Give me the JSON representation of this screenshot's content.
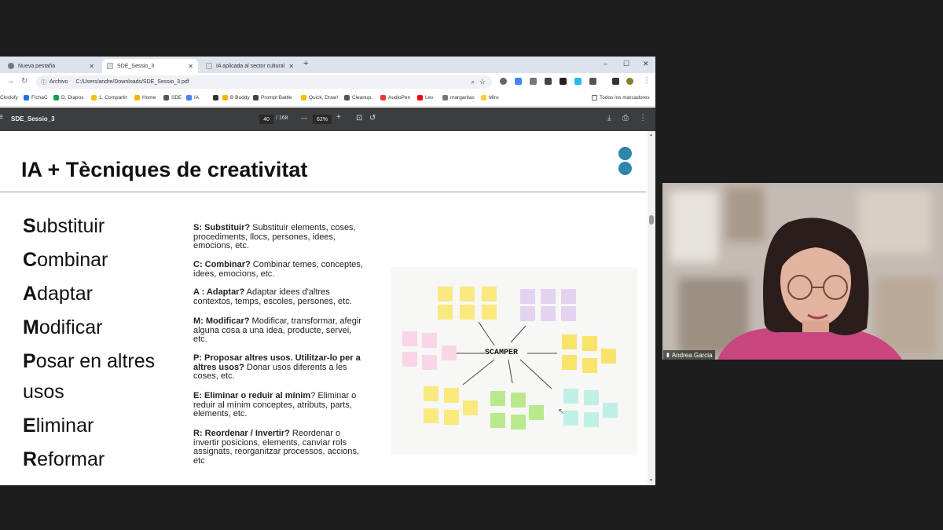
{
  "browser": {
    "tabs": [
      {
        "label": "Nueva pestaña",
        "active": false
      },
      {
        "label": "SDE_Sessio_3",
        "active": true
      },
      {
        "label": "IA aplicada al sector cultural",
        "active": false
      }
    ],
    "new_tab": "+",
    "win_minimize": "–",
    "win_maximize": "☐",
    "win_close": "✕",
    "address_chip": "Archivo",
    "address": "C:/Users/andre/Downloads/SDE_Sessio_3.pdf",
    "bookmarks": [
      {
        "label": "Clockify",
        "color": "#03a9f4"
      },
      {
        "label": "FichaC",
        "color": "#1a73e8"
      },
      {
        "label": "D. Diapos",
        "color": "#0f9d58"
      },
      {
        "label": "1. Compartir",
        "color": "#fbbc04"
      },
      {
        "label": "Home",
        "color": "#f4b400"
      },
      {
        "label": "SDE",
        "color": "#555555"
      },
      {
        "label": "IA",
        "color": "#4285f4"
      },
      {
        "label": "",
        "color": "#333333"
      },
      {
        "label": "B Buddy",
        "color": "#f4b400"
      },
      {
        "label": "Prompt Battle",
        "color": "#444444"
      },
      {
        "label": "Quick, Draw!",
        "color": "#fbbc04"
      },
      {
        "label": "Cleanup.",
        "color": "#555555"
      },
      {
        "label": "AudioPen",
        "color": "#e53935"
      },
      {
        "label": "Lev",
        "color": "#ff0000"
      },
      {
        "label": "margaritas",
        "color": "#777777"
      },
      {
        "label": "Miro",
        "color": "#ffd02f"
      }
    ],
    "all_bookmarks": "Todos los marcadores"
  },
  "pdf": {
    "title": "SDE_Sessio_3",
    "page": "40",
    "total": "/ 168",
    "zoom": "62%",
    "minus": "—",
    "plus": "+"
  },
  "slide": {
    "title": "IA + Tècniques de creativitat",
    "words": [
      {
        "initial": "S",
        "rest": "ubstituir"
      },
      {
        "initial": "C",
        "rest": "ombinar"
      },
      {
        "initial": "A",
        "rest": "daptar"
      },
      {
        "initial": "M",
        "rest": "odificar"
      },
      {
        "initial": "P",
        "rest": "osar en altres"
      },
      {
        "initial": "",
        "rest": "usos"
      },
      {
        "initial": "E",
        "rest": "liminar"
      },
      {
        "initial": "R",
        "rest": "eformar"
      }
    ],
    "descriptions": [
      {
        "bold": "S: Substituir?",
        "text": " Substituir elements, coses, procediments, llocs, persones, idees, emocions, etc."
      },
      {
        "bold": "C: Combinar?",
        "text": " Combinar temes, conceptes, idees, emocions, etc."
      },
      {
        "bold": "A : Adaptar?",
        "text": " Adaptar idees d'altres contextos, temps, escoles, persones, etc."
      },
      {
        "bold": "M: Modificar?",
        "text": " Modificar, transformar, afegir alguna cosa a una idea, producte, servei, etc."
      },
      {
        "bold": "P: Proposar altres usos. Utilitzar-lo per a altres usos?",
        "text": " Donar usos diferents a les coses, etc."
      },
      {
        "bold": "E: Eliminar o reduir al mínim",
        "text": "? Eliminar o reduir al mínim conceptes, atributs, parts, elements, etc."
      },
      {
        "bold": "R: Reordenar / Invertir?",
        "text": " Reordenar o invertir posicions, elements, canviar rols assignats, reorganitzar processos, accions, etc"
      }
    ],
    "scamper_label": "SCAMPER",
    "note_colors": {
      "yellow": "#f9e97e",
      "purple": "#e3d3f1",
      "pink": "#f8d5e7",
      "yellow_orange": "#f9e36a",
      "green": "#b8ea8d",
      "cyan": "#bff0e6"
    },
    "accent_dot": "#2e86ab"
  },
  "webcam": {
    "name": "Andrea Garcia"
  }
}
